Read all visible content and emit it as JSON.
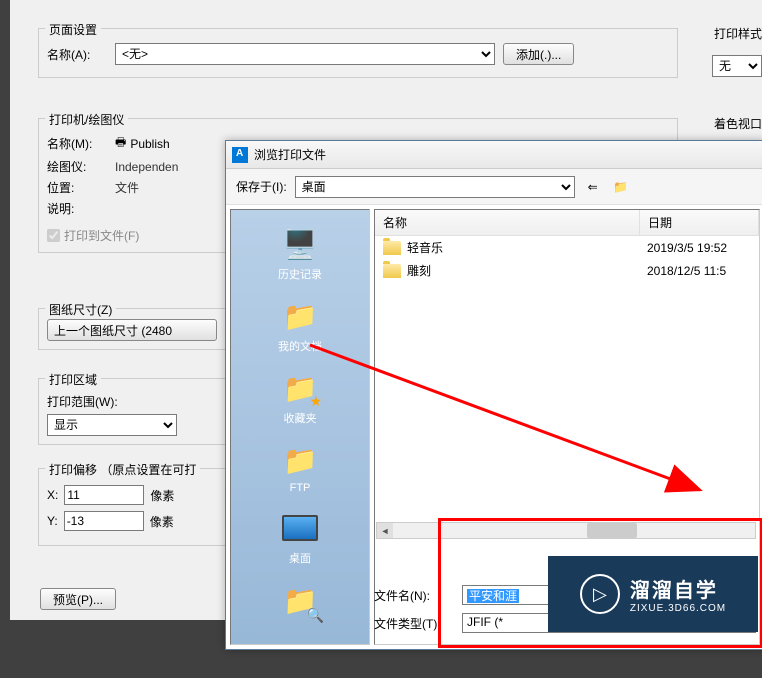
{
  "page_setup": {
    "legend": "页面设置",
    "name_label": "名称(A):",
    "name_value": "<无>",
    "add_button": "添加(.)..."
  },
  "print_style": {
    "legend": "打印样式",
    "value": "无"
  },
  "printer": {
    "legend": "打印机/绘图仪",
    "name_label": "名称(M):",
    "name_value": "Publish",
    "plotter_label": "绘图仪:",
    "plotter_value": "Independen",
    "location_label": "位置:",
    "location_value": "文件",
    "description_label": "说明:",
    "print_to_file": "打印到文件(F)"
  },
  "shade_viewport": {
    "legend": "着色视口"
  },
  "paper": {
    "legend": "图纸尺寸(Z)",
    "button": "上一个图纸尺寸  (2480"
  },
  "print_area": {
    "legend": "打印区域",
    "range_label": "打印范围(W):",
    "range_value": "显示"
  },
  "print_offset": {
    "legend": "打印偏移 （原点设置在可打",
    "x_label": "X:",
    "x_value": "11",
    "y_label": "Y:",
    "y_value": "-13",
    "unit": "像素"
  },
  "preview_button": "预览(P)...",
  "save_dialog": {
    "title": "浏览打印文件",
    "save_in_label": "保存于(I):",
    "save_in_value": "桌面",
    "columns": {
      "name": "名称",
      "date": "日期"
    },
    "files": [
      {
        "name": "轻音乐",
        "date": "2019/3/5 19:52"
      },
      {
        "name": "雕刻",
        "date": "2018/12/5 11:5"
      }
    ],
    "sidebar": [
      {
        "key": "history",
        "label": "历史记录"
      },
      {
        "key": "mydocs",
        "label": "我的文档"
      },
      {
        "key": "favorites",
        "label": "收藏夹"
      },
      {
        "key": "ftp",
        "label": "FTP"
      },
      {
        "key": "desktop",
        "label": "桌面"
      }
    ],
    "filename_label": "文件名(N):",
    "filename_value": "平安和涯",
    "filetype_label": "文件类型(T):",
    "filetype_value": "JFIF (*"
  },
  "watermark": {
    "big": "溜溜自学",
    "small": "ZIXUE.3D66.COM"
  }
}
